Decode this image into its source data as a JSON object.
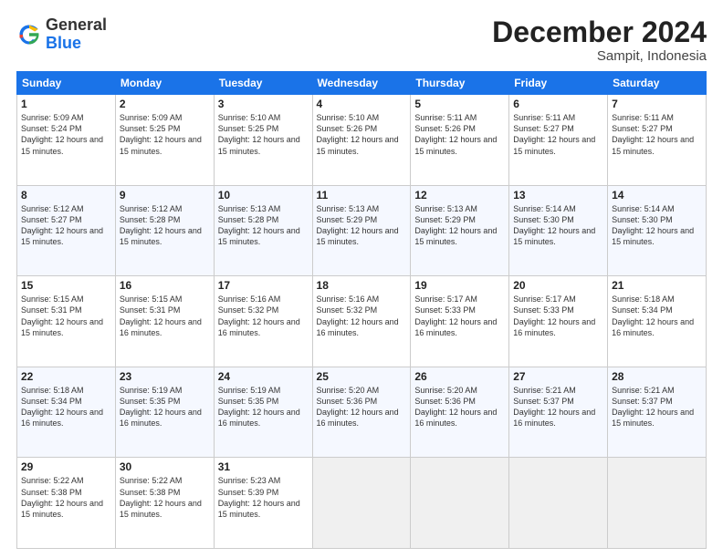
{
  "logo": {
    "general": "General",
    "blue": "Blue"
  },
  "header": {
    "month": "December 2024",
    "location": "Sampit, Indonesia"
  },
  "weekdays": [
    "Sunday",
    "Monday",
    "Tuesday",
    "Wednesday",
    "Thursday",
    "Friday",
    "Saturday"
  ],
  "weeks": [
    [
      {
        "day": "1",
        "sunrise": "5:09 AM",
        "sunset": "5:24 PM",
        "daylight": "12 hours and 15 minutes."
      },
      {
        "day": "2",
        "sunrise": "5:09 AM",
        "sunset": "5:25 PM",
        "daylight": "12 hours and 15 minutes."
      },
      {
        "day": "3",
        "sunrise": "5:10 AM",
        "sunset": "5:25 PM",
        "daylight": "12 hours and 15 minutes."
      },
      {
        "day": "4",
        "sunrise": "5:10 AM",
        "sunset": "5:26 PM",
        "daylight": "12 hours and 15 minutes."
      },
      {
        "day": "5",
        "sunrise": "5:11 AM",
        "sunset": "5:26 PM",
        "daylight": "12 hours and 15 minutes."
      },
      {
        "day": "6",
        "sunrise": "5:11 AM",
        "sunset": "5:27 PM",
        "daylight": "12 hours and 15 minutes."
      },
      {
        "day": "7",
        "sunrise": "5:11 AM",
        "sunset": "5:27 PM",
        "daylight": "12 hours and 15 minutes."
      }
    ],
    [
      {
        "day": "8",
        "sunrise": "5:12 AM",
        "sunset": "5:27 PM",
        "daylight": "12 hours and 15 minutes."
      },
      {
        "day": "9",
        "sunrise": "5:12 AM",
        "sunset": "5:28 PM",
        "daylight": "12 hours and 15 minutes."
      },
      {
        "day": "10",
        "sunrise": "5:13 AM",
        "sunset": "5:28 PM",
        "daylight": "12 hours and 15 minutes."
      },
      {
        "day": "11",
        "sunrise": "5:13 AM",
        "sunset": "5:29 PM",
        "daylight": "12 hours and 15 minutes."
      },
      {
        "day": "12",
        "sunrise": "5:13 AM",
        "sunset": "5:29 PM",
        "daylight": "12 hours and 15 minutes."
      },
      {
        "day": "13",
        "sunrise": "5:14 AM",
        "sunset": "5:30 PM",
        "daylight": "12 hours and 15 minutes."
      },
      {
        "day": "14",
        "sunrise": "5:14 AM",
        "sunset": "5:30 PM",
        "daylight": "12 hours and 15 minutes."
      }
    ],
    [
      {
        "day": "15",
        "sunrise": "5:15 AM",
        "sunset": "5:31 PM",
        "daylight": "12 hours and 15 minutes."
      },
      {
        "day": "16",
        "sunrise": "5:15 AM",
        "sunset": "5:31 PM",
        "daylight": "12 hours and 16 minutes."
      },
      {
        "day": "17",
        "sunrise": "5:16 AM",
        "sunset": "5:32 PM",
        "daylight": "12 hours and 16 minutes."
      },
      {
        "day": "18",
        "sunrise": "5:16 AM",
        "sunset": "5:32 PM",
        "daylight": "12 hours and 16 minutes."
      },
      {
        "day": "19",
        "sunrise": "5:17 AM",
        "sunset": "5:33 PM",
        "daylight": "12 hours and 16 minutes."
      },
      {
        "day": "20",
        "sunrise": "5:17 AM",
        "sunset": "5:33 PM",
        "daylight": "12 hours and 16 minutes."
      },
      {
        "day": "21",
        "sunrise": "5:18 AM",
        "sunset": "5:34 PM",
        "daylight": "12 hours and 16 minutes."
      }
    ],
    [
      {
        "day": "22",
        "sunrise": "5:18 AM",
        "sunset": "5:34 PM",
        "daylight": "12 hours and 16 minutes."
      },
      {
        "day": "23",
        "sunrise": "5:19 AM",
        "sunset": "5:35 PM",
        "daylight": "12 hours and 16 minutes."
      },
      {
        "day": "24",
        "sunrise": "5:19 AM",
        "sunset": "5:35 PM",
        "daylight": "12 hours and 16 minutes."
      },
      {
        "day": "25",
        "sunrise": "5:20 AM",
        "sunset": "5:36 PM",
        "daylight": "12 hours and 16 minutes."
      },
      {
        "day": "26",
        "sunrise": "5:20 AM",
        "sunset": "5:36 PM",
        "daylight": "12 hours and 16 minutes."
      },
      {
        "day": "27",
        "sunrise": "5:21 AM",
        "sunset": "5:37 PM",
        "daylight": "12 hours and 16 minutes."
      },
      {
        "day": "28",
        "sunrise": "5:21 AM",
        "sunset": "5:37 PM",
        "daylight": "12 hours and 15 minutes."
      }
    ],
    [
      {
        "day": "29",
        "sunrise": "5:22 AM",
        "sunset": "5:38 PM",
        "daylight": "12 hours and 15 minutes."
      },
      {
        "day": "30",
        "sunrise": "5:22 AM",
        "sunset": "5:38 PM",
        "daylight": "12 hours and 15 minutes."
      },
      {
        "day": "31",
        "sunrise": "5:23 AM",
        "sunset": "5:39 PM",
        "daylight": "12 hours and 15 minutes."
      },
      null,
      null,
      null,
      null
    ]
  ]
}
